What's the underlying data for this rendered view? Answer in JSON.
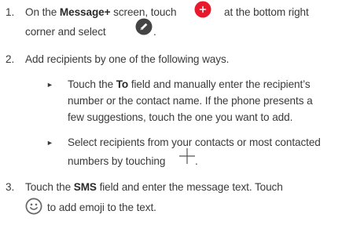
{
  "steps": [
    {
      "number": "1.",
      "line1_a": "On the ",
      "line1_bold": "Message+",
      "line1_b": " screen, touch",
      "line1_c": "at the bottom right",
      "line2_a": "corner and select",
      "line2_b": "."
    },
    {
      "number": "2.",
      "line1": "Add recipients by one of the following ways.",
      "bullets": [
        {
          "arrow": "►",
          "l1_a": "Touch the ",
          "l1_bold": "To",
          "l1_b": " field and manually enter the recipient’s",
          "l2": "number or the contact name. If the phone presents a",
          "l3": "few suggestions, touch the one you want to add."
        },
        {
          "arrow": "►",
          "l1": "Select recipients from your contacts or most contacted",
          "l2_a": "numbers by touching",
          "l2_b": "."
        }
      ]
    },
    {
      "number": "3.",
      "line1_a": "Touch the ",
      "line1_bold": "SMS",
      "line1_b": " field and enter the message text. Touch",
      "line2": "to add emoji to the text."
    }
  ],
  "icons": {
    "add_fab": {
      "name": "add-icon",
      "color": "#e8192c"
    },
    "compose": {
      "name": "compose-icon",
      "color": "#444444"
    },
    "plus": {
      "name": "plus-icon",
      "color": "#555555"
    },
    "emoji": {
      "name": "smiley-icon",
      "color": "#666666"
    }
  }
}
